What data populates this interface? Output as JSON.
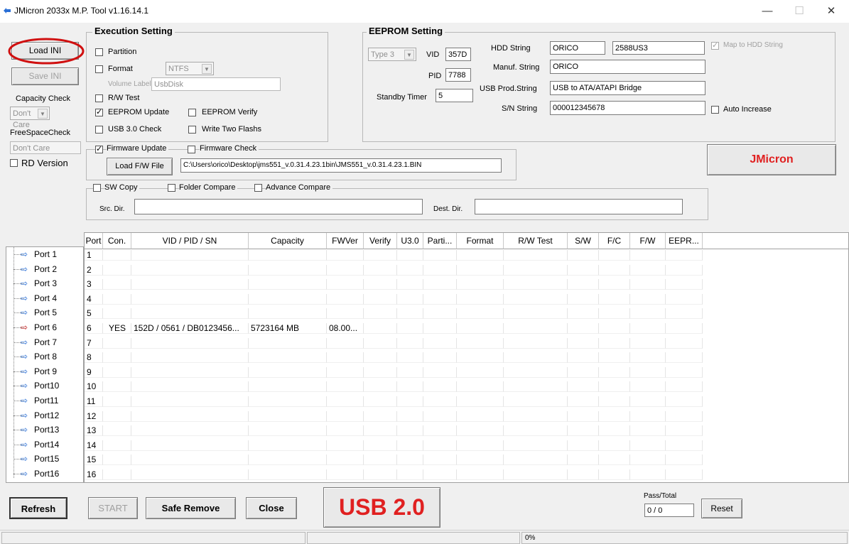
{
  "window": {
    "title": "JMicron 2033x M.P. Tool v1.16.14.1",
    "minimize": "—",
    "maximize": "☐",
    "close": "✕"
  },
  "left": {
    "load_ini": "Load INI",
    "save_ini": "Save INI",
    "capacity_check_label": "Capacity Check",
    "capacity_check_value": "Don't Care",
    "freespace_label": "FreeSpaceCheck",
    "freespace_value": "Don't Care",
    "rd_version": "RD Version"
  },
  "exec": {
    "title": "Execution Setting",
    "partition": "Partition",
    "format": "Format",
    "format_fs": "NTFS",
    "volume_label": "Volume Label",
    "volume_value": "UsbDisk",
    "rw_test": "R/W Test",
    "eeprom_update": "EEPROM Update",
    "eeprom_verify": "EEPROM Verify",
    "usb3_check": "USB 3.0 Check",
    "write_two_flashs": "Write Two Flashs",
    "firmware_update": "Firmware Update",
    "firmware_check": "Firmware Check",
    "load_fw": "Load F/W File",
    "fw_path": "C:\\Users\\orico\\Desktop\\jms551_v.0.31.4.23.1bin\\JMS551_v.0.31.4.23.1.BIN",
    "sw_copy": "SW Copy",
    "folder_compare": "Folder Compare",
    "advance_compare": "Advance Compare",
    "src_dir": "Src. Dir.",
    "dest_dir": "Dest. Dir."
  },
  "eeprom": {
    "title": "EEPROM Setting",
    "type": "Type 3",
    "vid_label": "VID",
    "vid": "357D",
    "pid_label": "PID",
    "pid": "7788",
    "standby_label": "Standby Timer",
    "standby": "5",
    "hdd_label": "HDD String",
    "hdd_1": "ORICO",
    "hdd_2": "2588US3",
    "map_hdd": "Map to HDD String",
    "manuf_label": "Manuf. String",
    "manuf": "ORICO",
    "usbprod_label": "USB Prod.String",
    "usbprod": "USB to ATA/ATAPI Bridge",
    "sn_label": "S/N String",
    "sn": "000012345678",
    "auto_increase": "Auto Increase"
  },
  "brand": {
    "text": "JMicron",
    "color": "#e02020"
  },
  "tree": {
    "ports": [
      "Port  1",
      "Port  2",
      "Port  3",
      "Port  4",
      "Port  5",
      "Port  6",
      "Port  7",
      "Port  8",
      "Port  9",
      "Port10",
      "Port11",
      "Port12",
      "Port13",
      "Port14",
      "Port15",
      "Port16"
    ]
  },
  "grid": {
    "headers": [
      "Port",
      "Con.",
      "VID / PID / SN",
      "Capacity",
      "FWVer",
      "Verify",
      "U3.0",
      "Parti...",
      "Format",
      "R/W Test",
      "S/W",
      "F/C",
      "F/W",
      "EEPR..."
    ],
    "rows": [
      [
        "1",
        "",
        "",
        "",
        "",
        "",
        "",
        "",
        "",
        "",
        "",
        "",
        "",
        ""
      ],
      [
        "2",
        "",
        "",
        "",
        "",
        "",
        "",
        "",
        "",
        "",
        "",
        "",
        "",
        ""
      ],
      [
        "3",
        "",
        "",
        "",
        "",
        "",
        "",
        "",
        "",
        "",
        "",
        "",
        "",
        ""
      ],
      [
        "4",
        "",
        "",
        "",
        "",
        "",
        "",
        "",
        "",
        "",
        "",
        "",
        "",
        ""
      ],
      [
        "5",
        "",
        "",
        "",
        "",
        "",
        "",
        "",
        "",
        "",
        "",
        "",
        "",
        ""
      ],
      [
        "6",
        "YES",
        "152D / 0561 / DB0123456...",
        "5723164 MB",
        "08.00...",
        "",
        "",
        "",
        "",
        "",
        "",
        "",
        "",
        ""
      ],
      [
        "7",
        "",
        "",
        "",
        "",
        "",
        "",
        "",
        "",
        "",
        "",
        "",
        "",
        ""
      ],
      [
        "8",
        "",
        "",
        "",
        "",
        "",
        "",
        "",
        "",
        "",
        "",
        "",
        "",
        ""
      ],
      [
        "9",
        "",
        "",
        "",
        "",
        "",
        "",
        "",
        "",
        "",
        "",
        "",
        "",
        ""
      ],
      [
        "10",
        "",
        "",
        "",
        "",
        "",
        "",
        "",
        "",
        "",
        "",
        "",
        "",
        ""
      ],
      [
        "11",
        "",
        "",
        "",
        "",
        "",
        "",
        "",
        "",
        "",
        "",
        "",
        "",
        ""
      ],
      [
        "12",
        "",
        "",
        "",
        "",
        "",
        "",
        "",
        "",
        "",
        "",
        "",
        "",
        ""
      ],
      [
        "13",
        "",
        "",
        "",
        "",
        "",
        "",
        "",
        "",
        "",
        "",
        "",
        "",
        ""
      ],
      [
        "14",
        "",
        "",
        "",
        "",
        "",
        "",
        "",
        "",
        "",
        "",
        "",
        "",
        ""
      ],
      [
        "15",
        "",
        "",
        "",
        "",
        "",
        "",
        "",
        "",
        "",
        "",
        "",
        "",
        ""
      ],
      [
        "16",
        "",
        "",
        "",
        "",
        "",
        "",
        "",
        "",
        "",
        "",
        "",
        "",
        ""
      ]
    ]
  },
  "bottom": {
    "refresh": "Refresh",
    "start": "START",
    "safe_remove": "Safe Remove",
    "close": "Close",
    "usb_mode": "USB 2.0",
    "pass_total_label": "Pass/Total",
    "pass_total": "0 / 0",
    "reset": "Reset"
  },
  "status": {
    "progress": "0%"
  },
  "colors": {
    "accent_red": "#e02020",
    "annotation_red": "#d01010",
    "usb_icon": "#2a6fd6"
  }
}
